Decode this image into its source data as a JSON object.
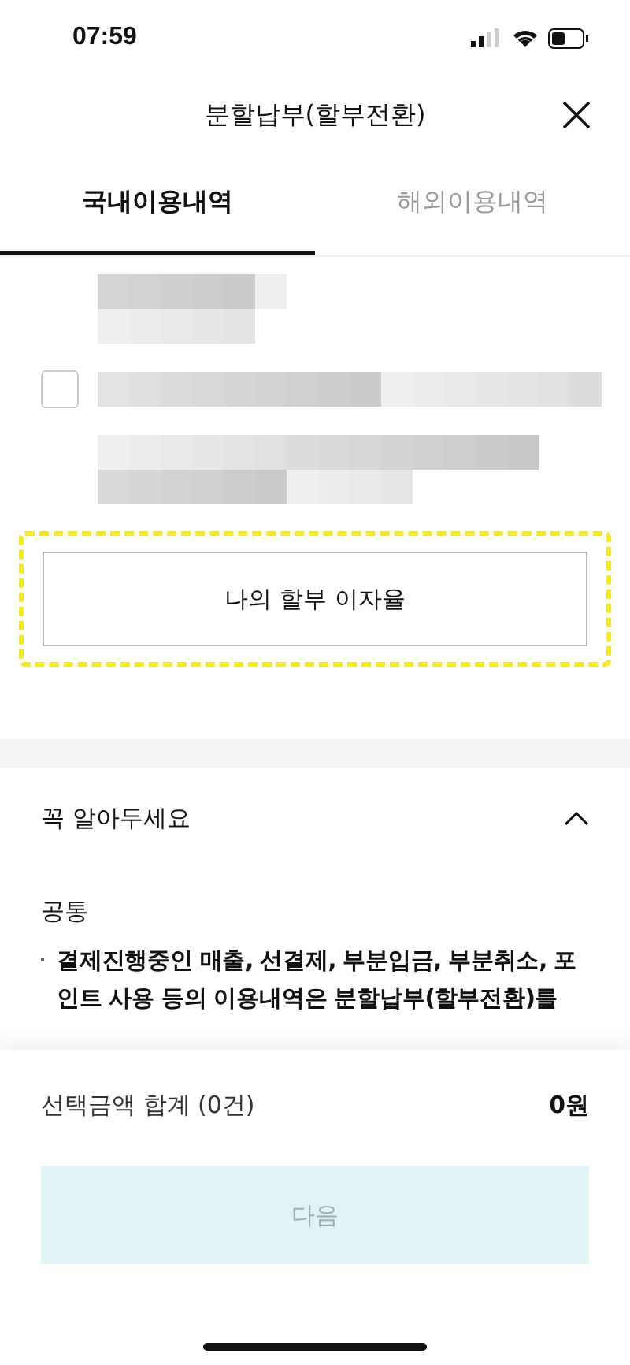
{
  "status_bar": {
    "time": "07:59"
  },
  "header": {
    "title": "분할납부(할부전환)"
  },
  "tabs": [
    {
      "label": "국내이용내역",
      "selected": true
    },
    {
      "label": "해외이용내역",
      "selected": false
    }
  ],
  "transaction": {
    "checked": false
  },
  "rate_button": {
    "label": "나의 할부 이자율",
    "highlighted": true
  },
  "notice": {
    "title": "꼭 알아두세요",
    "expanded": true,
    "section": "공통",
    "bullets": [
      "결제진행중인 매출, 선결제, 부분입금, 부분취소, 포인트 사용 등의 이용내역은 분할납부(할부전환)를"
    ]
  },
  "summary": {
    "label": "선택금액 합계 (0건)",
    "amount": "0원"
  },
  "next_button": {
    "label": "다음",
    "disabled": true
  }
}
